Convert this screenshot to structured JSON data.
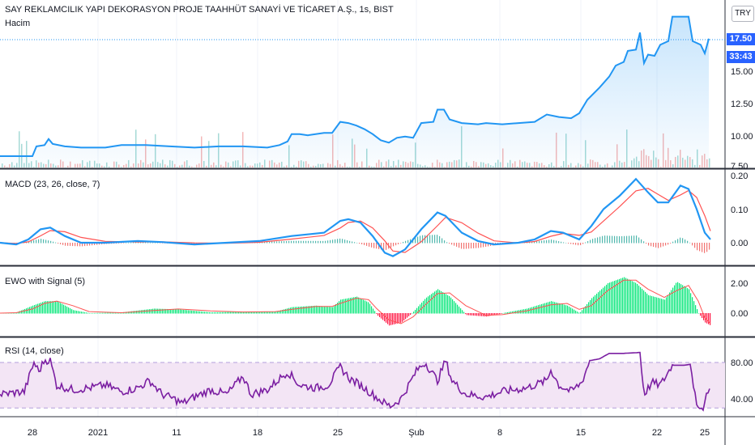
{
  "header": {
    "title": "SAY REKLAMCILIK YAPI DEKORASYON PROJE TAAHHÜT SANAYİ VE TİCARET A.Ş., 1s, BIST",
    "volume_label": "Hacim",
    "currency": "TRY"
  },
  "price_tag": {
    "price": "17.50",
    "countdown": "33:43"
  },
  "colors": {
    "price_line": "#2196f3",
    "macd_line": "#2196f3",
    "macd_signal": "#ff5252",
    "ewo_pos": "#00e676",
    "ewo_neg": "#ff1744",
    "rsi_line": "#7b1fa2",
    "rsi_band": "#f3e5f5",
    "tag": "#2962ff"
  },
  "panes": {
    "macd": {
      "label": "MACD (23, 26, close, 7)",
      "ticks": [
        "0.20",
        "0.10",
        "0.00"
      ]
    },
    "ewo": {
      "label": "EWO with Signal (5)",
      "ticks": [
        "2.00",
        "0.00"
      ]
    },
    "rsi": {
      "label": "RSI (14, close)",
      "ticks": [
        "80.00",
        "40.00"
      ]
    }
  },
  "chart_data": [
    {
      "type": "line",
      "name": "price",
      "y_ticks": [
        "15.00",
        "12.50",
        "10.00",
        "7.50"
      ],
      "ylim": [
        7.5,
        20
      ],
      "points": [
        [
          0,
          7.9
        ],
        [
          40,
          7.9
        ],
        [
          45,
          8.7
        ],
        [
          55,
          8.8
        ],
        [
          60,
          9.3
        ],
        [
          65,
          8.9
        ],
        [
          80,
          8.7
        ],
        [
          100,
          8.6
        ],
        [
          130,
          8.6
        ],
        [
          150,
          8.8
        ],
        [
          180,
          8.8
        ],
        [
          210,
          8.7
        ],
        [
          240,
          8.6
        ],
        [
          270,
          8.7
        ],
        [
          300,
          8.7
        ],
        [
          330,
          8.6
        ],
        [
          345,
          8.8
        ],
        [
          355,
          9.1
        ],
        [
          360,
          9.7
        ],
        [
          370,
          9.7
        ],
        [
          380,
          9.6
        ],
        [
          400,
          9.8
        ],
        [
          410,
          9.8
        ],
        [
          420,
          10.7
        ],
        [
          430,
          10.6
        ],
        [
          440,
          10.4
        ],
        [
          450,
          10.1
        ],
        [
          460,
          9.7
        ],
        [
          470,
          9.2
        ],
        [
          480,
          9.0
        ],
        [
          490,
          9.4
        ],
        [
          500,
          9.5
        ],
        [
          510,
          9.4
        ],
        [
          520,
          10.6
        ],
        [
          535,
          10.7
        ],
        [
          540,
          11.7
        ],
        [
          548,
          11.7
        ],
        [
          555,
          10.9
        ],
        [
          570,
          10.6
        ],
        [
          590,
          10.5
        ],
        [
          600,
          10.6
        ],
        [
          620,
          10.5
        ],
        [
          640,
          10.6
        ],
        [
          660,
          10.7
        ],
        [
          675,
          11.3
        ],
        [
          690,
          11.1
        ],
        [
          705,
          11.0
        ],
        [
          715,
          11.4
        ],
        [
          725,
          12.5
        ],
        [
          740,
          13.5
        ],
        [
          752,
          14.4
        ],
        [
          760,
          15.3
        ],
        [
          770,
          15.6
        ],
        [
          775,
          16.5
        ],
        [
          785,
          16.6
        ],
        [
          790,
          18.0
        ],
        [
          795,
          15.5
        ],
        [
          800,
          16.2
        ],
        [
          808,
          16.1
        ],
        [
          815,
          17.0
        ],
        [
          825,
          17.3
        ],
        [
          830,
          19.3
        ],
        [
          850,
          19.3
        ],
        [
          855,
          17.3
        ],
        [
          865,
          17.0
        ],
        [
          870,
          16.3
        ],
        [
          875,
          17.5
        ]
      ]
    },
    {
      "type": "line",
      "name": "MACD (23, 26, close, 7)",
      "series": [
        {
          "name": "macd"
        },
        {
          "name": "signal"
        }
      ],
      "ticks": [
        "0.20",
        "0.10",
        "0.00"
      ],
      "ylim": [
        -0.04,
        0.21
      ]
    },
    {
      "type": "bar",
      "name": "EWO with Signal (5)",
      "ticks": [
        "2.00",
        "0.00"
      ],
      "ylim": [
        -1.0,
        2.4
      ]
    },
    {
      "type": "line",
      "name": "RSI (14, close)",
      "ticks": [
        "80.00",
        "40.00"
      ],
      "ylim": [
        20,
        95
      ],
      "bands": [
        30,
        80
      ]
    }
  ],
  "x_axis": [
    {
      "label": "28",
      "x": 40
    },
    {
      "label": "2021",
      "x": 121
    },
    {
      "label": "11",
      "x": 218
    },
    {
      "label": "18",
      "x": 318
    },
    {
      "label": "25",
      "x": 417
    },
    {
      "label": "Şub",
      "x": 514
    },
    {
      "label": "8",
      "x": 617
    },
    {
      "label": "15",
      "x": 717
    },
    {
      "label": "22",
      "x": 811
    },
    {
      "label": "25",
      "x": 870
    }
  ]
}
